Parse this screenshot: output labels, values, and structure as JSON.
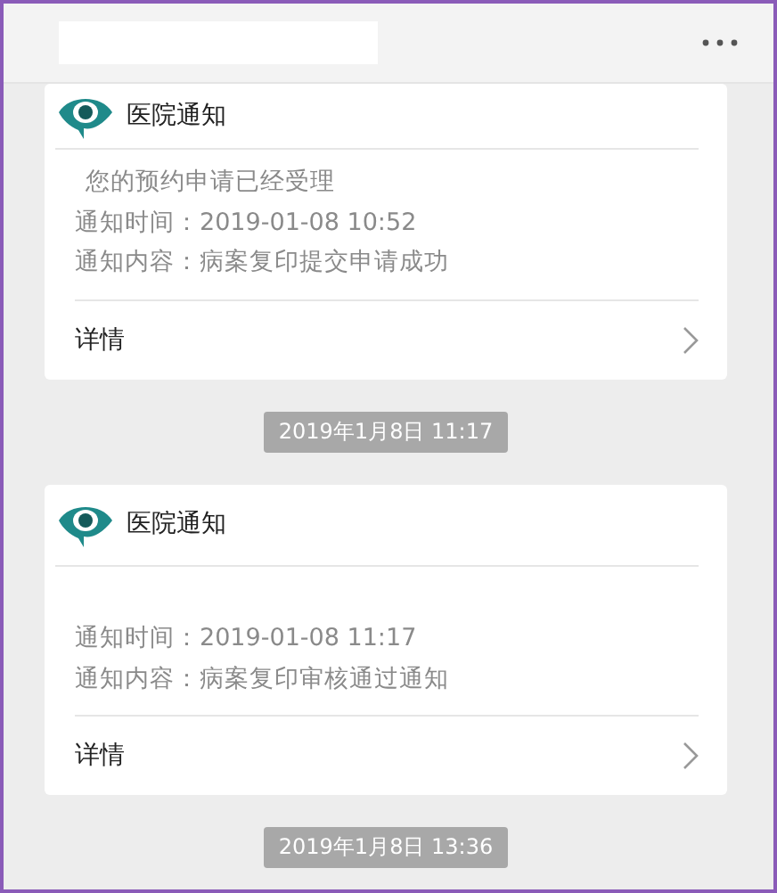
{
  "notifications": [
    {
      "source": "医院通知",
      "intro": "您的预约申请已经受理",
      "lines": [
        "通知时间：2019-01-08 10:52",
        "通知内容：病案复印提交申请成功"
      ],
      "link": "详情",
      "timestamp": "2019年1月8日 11:17"
    },
    {
      "source": "医院通知",
      "lines": [
        "通知时间：2019-01-08 11:17",
        "通知内容：病案复印审核通过通知"
      ],
      "link": "详情",
      "timestamp": "2019年1月8日 13:36"
    }
  ]
}
